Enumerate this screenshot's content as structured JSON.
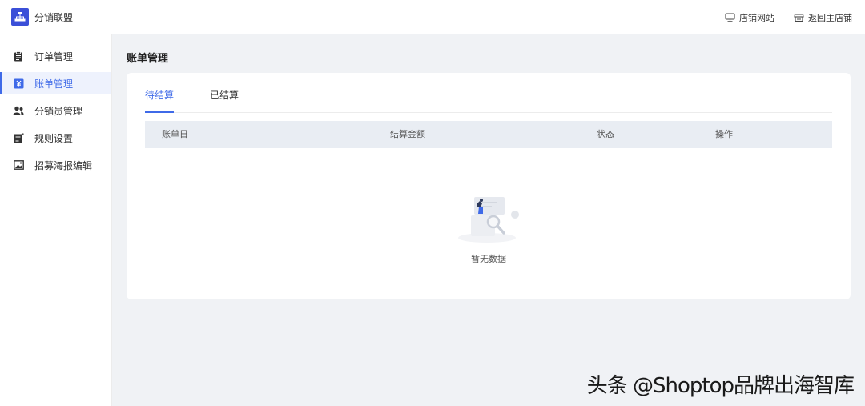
{
  "app": {
    "title": "分销联盟"
  },
  "header": {
    "links": [
      {
        "label": "店铺网站",
        "icon": "monitor-icon"
      },
      {
        "label": "返回主店铺",
        "icon": "store-icon"
      }
    ]
  },
  "sidebar": {
    "items": [
      {
        "label": "订单管理",
        "icon": "clipboard-icon",
        "active": false
      },
      {
        "label": "账单管理",
        "icon": "yen-icon",
        "active": true
      },
      {
        "label": "分销员管理",
        "icon": "users-icon",
        "active": false
      },
      {
        "label": "规则设置",
        "icon": "rules-icon",
        "active": false
      },
      {
        "label": "招募海报编辑",
        "icon": "image-icon",
        "active": false
      }
    ]
  },
  "main": {
    "title": "账单管理",
    "tabs": [
      {
        "label": "待结算",
        "active": true
      },
      {
        "label": "已结算",
        "active": false
      }
    ],
    "table": {
      "columns": [
        "账单日",
        "结算金额",
        "状态",
        "操作"
      ],
      "rows": []
    },
    "empty_text": "暂无数据"
  },
  "watermark": "头条 @Shoptop品牌出海智库",
  "colors": {
    "accent": "#3f6ae8",
    "logo": "#3b4fd8",
    "background": "#f0f2f5"
  }
}
